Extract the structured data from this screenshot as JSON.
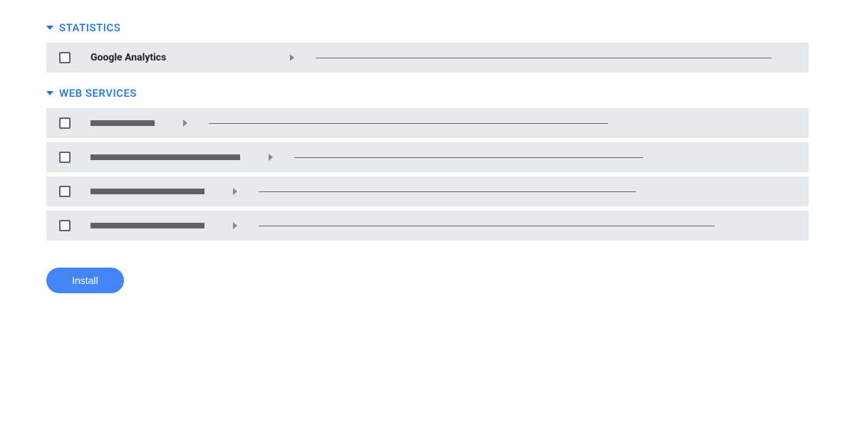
{
  "sections": {
    "statistics": {
      "title": "STATISTICS",
      "items": [
        {
          "label": "Google Analytics"
        }
      ]
    },
    "web_services": {
      "title": "WEB SERVICES"
    }
  },
  "buttons": {
    "install": "Install"
  },
  "colors": {
    "accent": "#1a73e8",
    "button_bg": "#4285f4",
    "row_bg": "#e8e9ea"
  }
}
